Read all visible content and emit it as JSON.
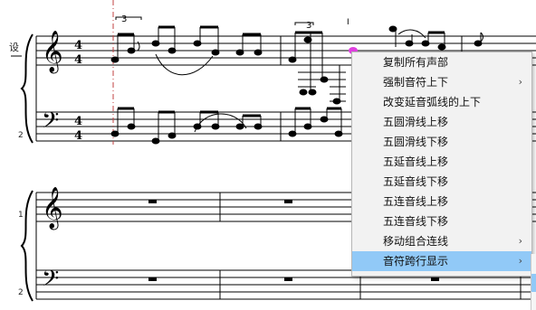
{
  "score": {
    "top_system": {
      "staff_prefix": "设",
      "lower_staff_number": "2",
      "time_signature": {
        "top": "4",
        "bottom": "4"
      },
      "tuplet_marks": [
        "3",
        "3"
      ],
      "selection_marker": "I"
    },
    "bottom_system": {
      "upper_staff_number": "1",
      "lower_staff_number": "2"
    }
  },
  "context_menu": {
    "items": [
      {
        "label": "复制所有声部",
        "has_submenu": false
      },
      {
        "label": "强制音符上下",
        "has_submenu": true
      },
      {
        "label": "改变延音弧线的上下",
        "has_submenu": false
      },
      {
        "label": "五圆滑线上移",
        "has_submenu": false
      },
      {
        "label": "五圆滑线下移",
        "has_submenu": false
      },
      {
        "label": "五延音线上移",
        "has_submenu": false
      },
      {
        "label": "五延音线下移",
        "has_submenu": false
      },
      {
        "label": "五连音线上移",
        "has_submenu": false
      },
      {
        "label": "五连音线下移",
        "has_submenu": false
      },
      {
        "label": "移动组合连线",
        "has_submenu": true
      },
      {
        "label": "音符跨行显示",
        "has_submenu": true,
        "highlighted": true
      }
    ],
    "submenu_arrow": "›"
  },
  "colors": {
    "menu_bg": "#f2f2f2",
    "menu_highlight": "#91c9f7",
    "selected_note": "#e040e0",
    "guide_line": "#c04040"
  }
}
